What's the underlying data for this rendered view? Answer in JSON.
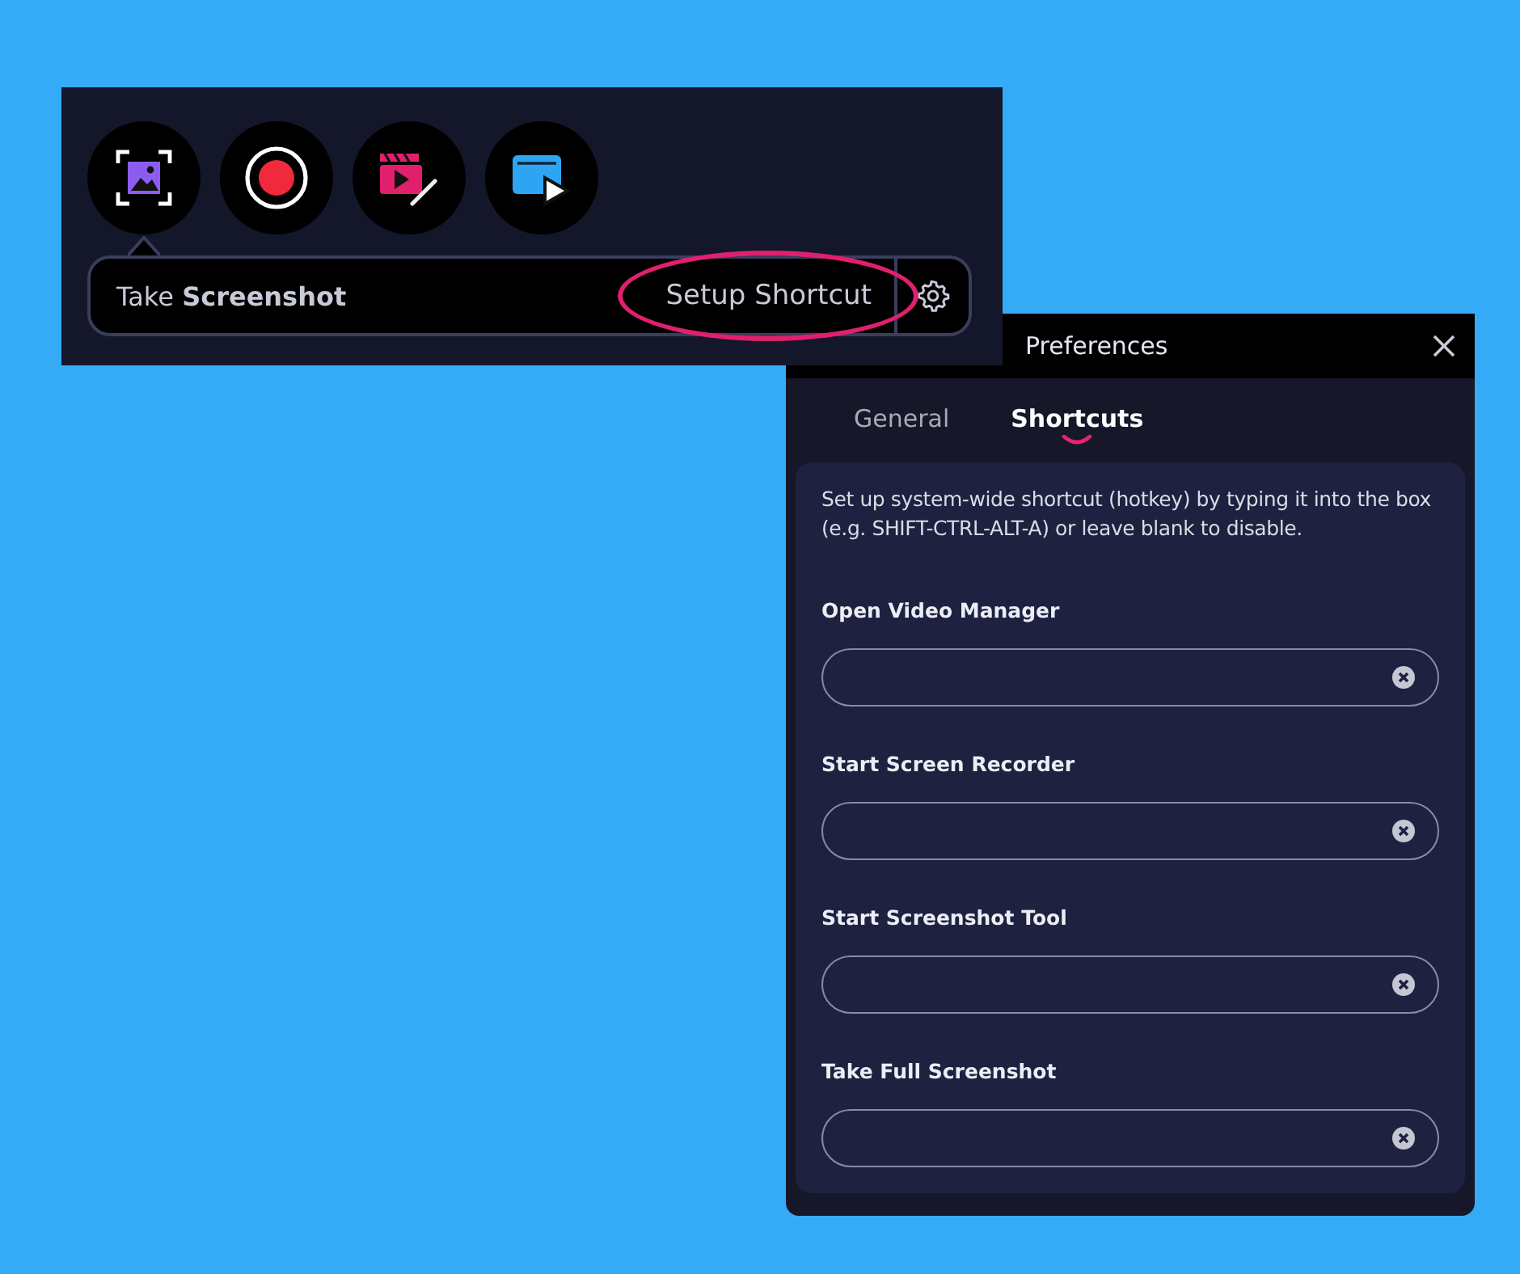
{
  "toolbar": {
    "tools": [
      {
        "kind": "screenshot",
        "selected": true
      },
      {
        "kind": "record",
        "selected": false
      },
      {
        "kind": "editor",
        "selected": false
      },
      {
        "kind": "player",
        "selected": false
      }
    ],
    "tooltip": {
      "action": "Take **Screenshot**",
      "link": "Setup Shortcut",
      "highlighted": true
    }
  },
  "preferences": {
    "title": "Preferences",
    "tabs": [
      {
        "label": "General",
        "selected": false
      },
      {
        "label": "Shortcuts",
        "selected": true
      }
    ],
    "description": "Set up system-wide shortcut (hotkey) by typing it into the box (e.g. SHIFT-CTRL-ALT-A) or leave blank to disable.",
    "shortcuts": [
      {
        "label": "Open Video Manager"
      },
      {
        "label": "Start Screen Recorder"
      },
      {
        "label": "Start Screenshot Tool"
      },
      {
        "label": "Take Full Screenshot"
      }
    ]
  }
}
